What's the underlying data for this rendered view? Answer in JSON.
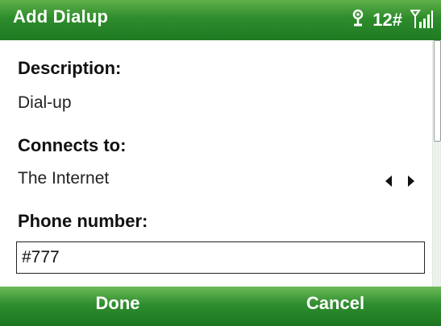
{
  "title_bar": {
    "title": "Add Dialup",
    "status": {
      "icons": [
        "antenna-icon",
        "signal-strength-icon"
      ],
      "network_value": "12#"
    }
  },
  "form": {
    "description": {
      "label": "Description:",
      "value": "Dial-up"
    },
    "connects_to": {
      "label": "Connects to:",
      "value": "The Internet",
      "icon": "left-right-arrows-icon"
    },
    "phone_number": {
      "label": "Phone number:",
      "value": "#777"
    }
  },
  "softkeys": {
    "left": "Done",
    "right": "Cancel"
  },
  "colors": {
    "title_bar": "#2e8c2c",
    "softkey_bar": "#2f8e2f",
    "text": "#111111"
  }
}
